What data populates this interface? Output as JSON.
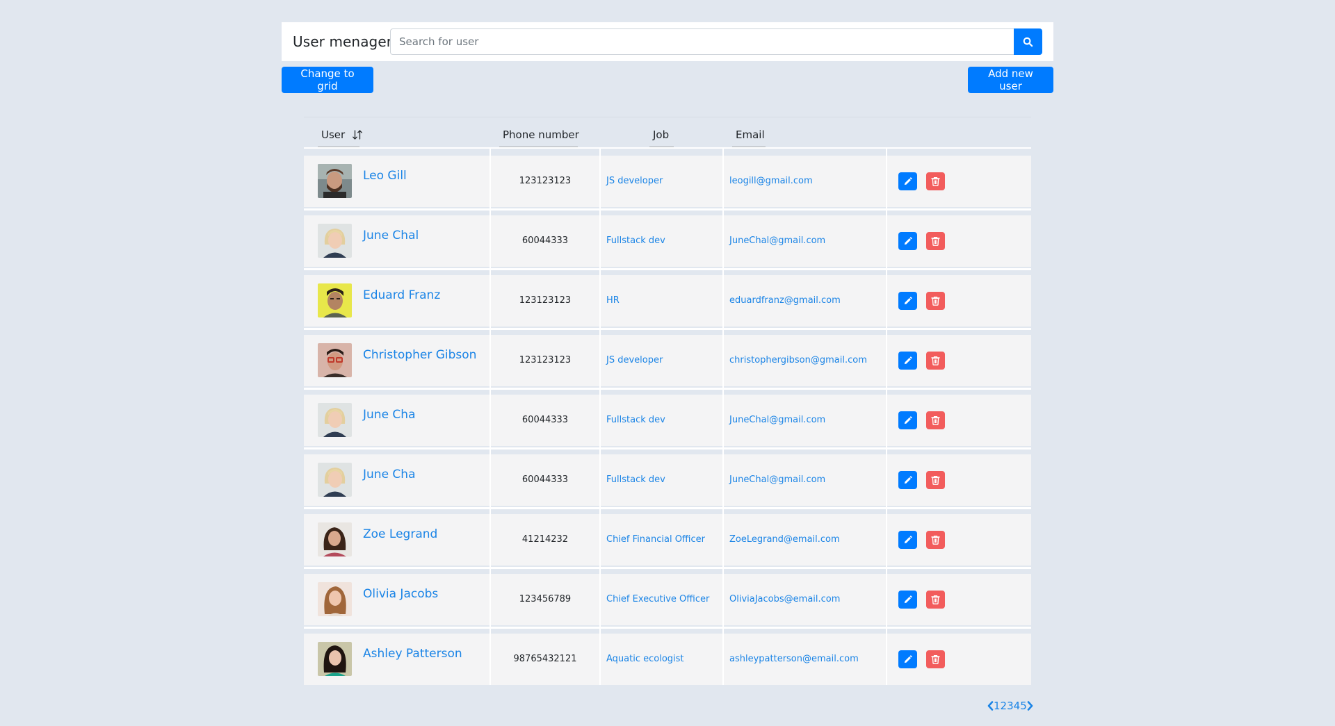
{
  "header": {
    "title": "User menager",
    "search_placeholder": "Search for user",
    "search_value": ""
  },
  "toolbar": {
    "change_view_label": "Change to grid",
    "add_user_label": "Add new user"
  },
  "table": {
    "columns": [
      "User",
      "Phone number",
      "Job",
      "Email"
    ],
    "rows": [
      {
        "name": "Leo Gill",
        "phone": "123123123",
        "job": "JS developer",
        "email": "leogill@gmail.com",
        "avatar": "male-beard"
      },
      {
        "name": "June Chal",
        "phone": "60044333",
        "job": "Fullstack dev",
        "email": "JuneChal@gmail.com",
        "avatar": "female-blonde"
      },
      {
        "name": "Eduard Franz",
        "phone": "123123123",
        "job": "HR",
        "email": "eduardfranz@gmail.com",
        "avatar": "male-yellow-bg"
      },
      {
        "name": "Christopher Gibson",
        "phone": "123123123",
        "job": "JS developer",
        "email": "christophergibson@gmail.com",
        "avatar": "male-glasses"
      },
      {
        "name": "June Cha",
        "phone": "60044333",
        "job": "Fullstack dev",
        "email": "JuneChal@gmail.com",
        "avatar": "female-blonde"
      },
      {
        "name": "June Cha",
        "phone": "60044333",
        "job": "Fullstack dev",
        "email": "JuneChal@gmail.com",
        "avatar": "female-blonde"
      },
      {
        "name": "Zoe Legrand",
        "phone": "41214232",
        "job": "Chief Financial Officer",
        "email": "ZoeLegrand@email.com",
        "avatar": "female-curly"
      },
      {
        "name": "Olivia Jacobs",
        "phone": "123456789",
        "job": "Chief Executive Officer",
        "email": "OliviaJacobs@email.com",
        "avatar": "female-long-hair"
      },
      {
        "name": "Ashley Patterson",
        "phone": "98765432121",
        "job": "Aquatic ecologist",
        "email": "ashleypatterson@email.com",
        "avatar": "female-dark-hair"
      }
    ]
  },
  "pagination": {
    "pages": [
      "1",
      "2",
      "3",
      "4",
      "5"
    ]
  },
  "colors": {
    "background": "#e1e7ef",
    "primary": "#007bff",
    "danger": "#f25c5c",
    "link": "#1a84e6",
    "row_bg": "#f4f4f5"
  },
  "icons": {
    "search": "search-icon",
    "sort": "sort-icon",
    "edit": "pencil-icon",
    "delete": "trash-icon",
    "prev": "chevron-left-icon",
    "next": "chevron-right-icon"
  }
}
